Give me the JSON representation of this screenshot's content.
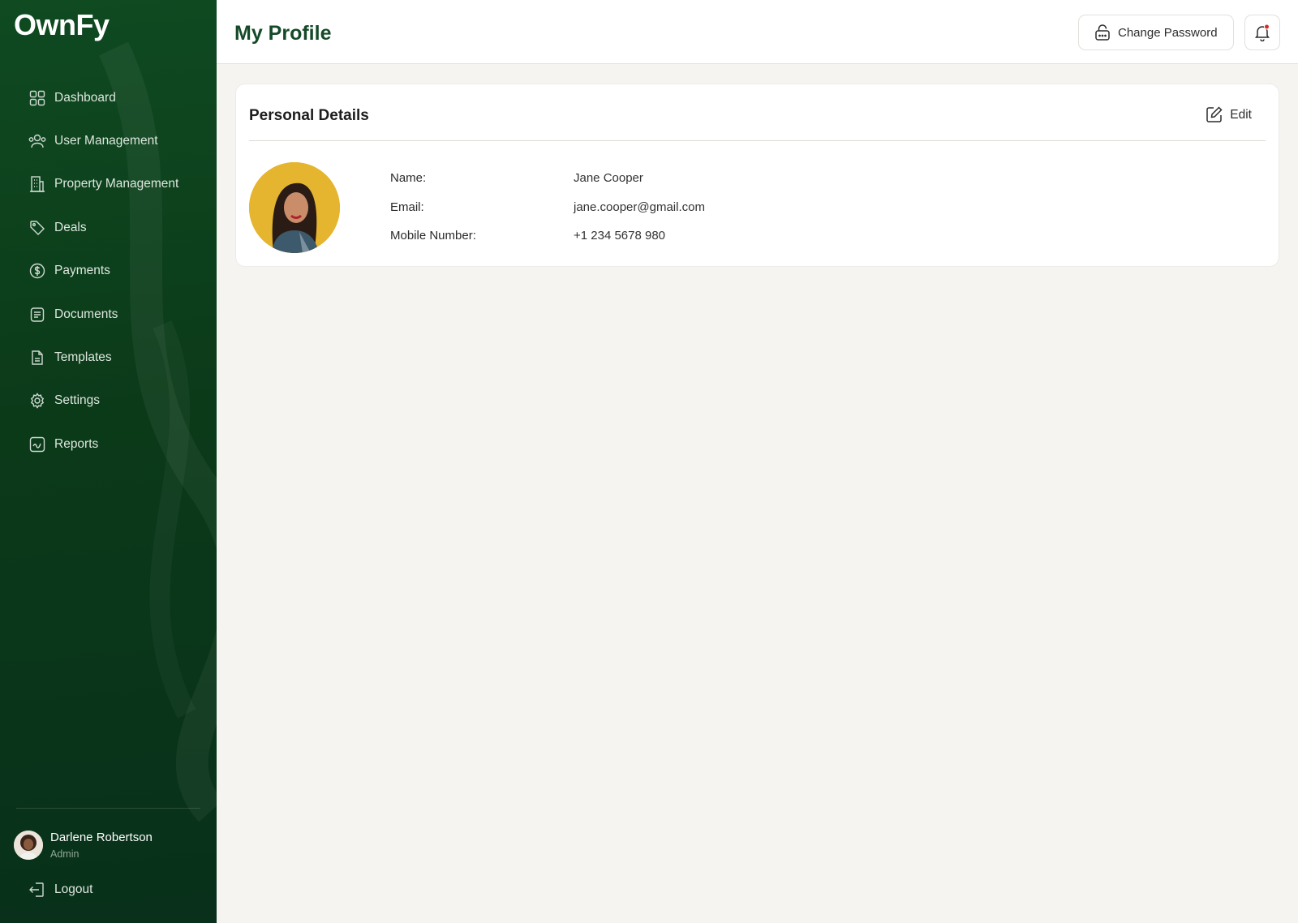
{
  "app": {
    "brand": "OwnFy"
  },
  "sidebar": {
    "items": [
      {
        "label": "Dashboard",
        "icon": "grid-icon"
      },
      {
        "label": "User Management",
        "icon": "users-icon"
      },
      {
        "label": "Property Management",
        "icon": "building-icon"
      },
      {
        "label": "Deals",
        "icon": "tag-icon"
      },
      {
        "label": "Payments",
        "icon": "dollar-icon"
      },
      {
        "label": "Documents",
        "icon": "document-icon"
      },
      {
        "label": "Templates",
        "icon": "file-icon"
      },
      {
        "label": "Settings",
        "icon": "gear-icon"
      },
      {
        "label": "Reports",
        "icon": "chart-icon"
      }
    ],
    "user": {
      "name": "Darlene Robertson",
      "role": "Admin"
    },
    "logout_label": "Logout"
  },
  "header": {
    "title": "My Profile",
    "change_password_label": "Change Password",
    "notification_dot_color": "#d62b2b"
  },
  "personal_details": {
    "title": "Personal Details",
    "edit_label": "Edit",
    "fields": [
      {
        "label": "Name:",
        "value": "Jane Cooper"
      },
      {
        "label": "Email:",
        "value": "jane.cooper@gmail.com"
      },
      {
        "label": "Mobile Number:",
        "value": "+1 234 5678 980"
      }
    ]
  },
  "colors": {
    "sidebar_bg": "#0b3a19",
    "accent": "#154a29",
    "page_bg": "#f5f4f1"
  }
}
